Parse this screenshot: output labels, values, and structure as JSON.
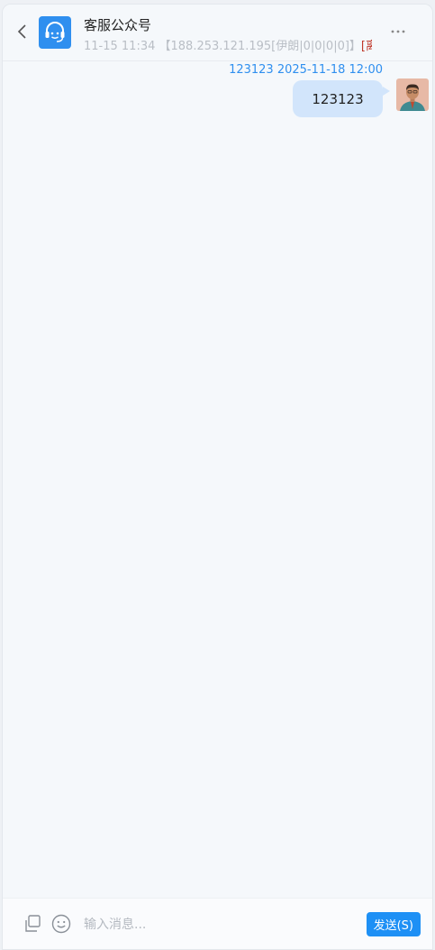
{
  "header": {
    "title": "客服公众号",
    "time": "11-15 11:34",
    "info": "【188.253.121.195[伊朗|0|0|0|0]】",
    "status": "[离线]",
    "back_icon": "chevron-left-icon",
    "avatar_icon": "headset-icon",
    "more_icon": "ellipsis-icon"
  },
  "messages": [
    {
      "sender": "123123",
      "timestamp": "2025-11-18 12:00",
      "text": "123123",
      "direction": "outgoing"
    }
  ],
  "input_bar": {
    "placeholder": "输入消息...",
    "send_label": "发送(S)",
    "icons": [
      "copy-icon",
      "emoji-icon"
    ]
  },
  "colors": {
    "accent": "#1e90f5",
    "bubble": "#d2e5fb",
    "status_offline": "#c0392b",
    "background": "#f5f8fb"
  }
}
